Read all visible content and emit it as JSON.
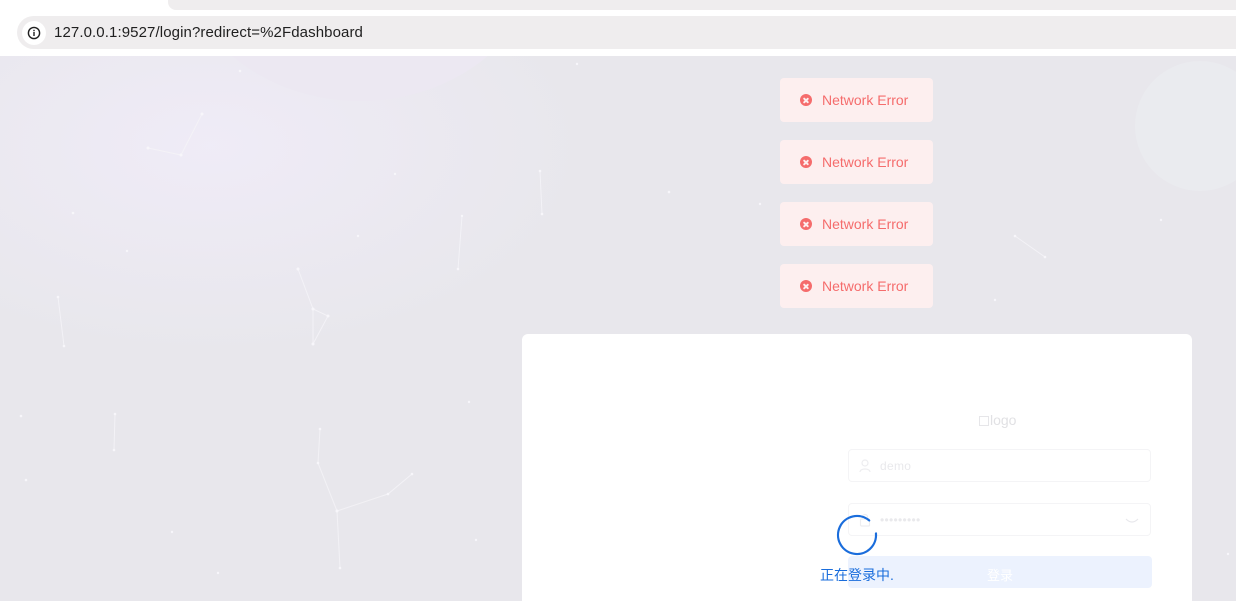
{
  "browser": {
    "url": "127.0.0.1:9527/login?redirect=%2Fdashboard",
    "site_info_icon": "info-icon"
  },
  "toasts": [
    {
      "text": "Network Error",
      "icon": "error-circle-icon",
      "type": "error",
      "color": "#f56c6c"
    },
    {
      "text": "Network Error",
      "icon": "error-circle-icon",
      "type": "error",
      "color": "#f56c6c"
    },
    {
      "text": "Network Error",
      "icon": "error-circle-icon",
      "type": "error",
      "color": "#f56c6c"
    },
    {
      "text": "Network Error",
      "icon": "error-circle-icon",
      "type": "error",
      "color": "#f56c6c"
    }
  ],
  "login": {
    "logo_alt": "logo",
    "username": {
      "value": "demo",
      "icon": "user-icon"
    },
    "password": {
      "value": "•••••••••",
      "icon": "lock-icon",
      "toggle_icon": "eye-closed-icon"
    },
    "submit_label": "登录"
  },
  "loading": {
    "text": "正在登录中.",
    "color": "#1a6ddc"
  }
}
